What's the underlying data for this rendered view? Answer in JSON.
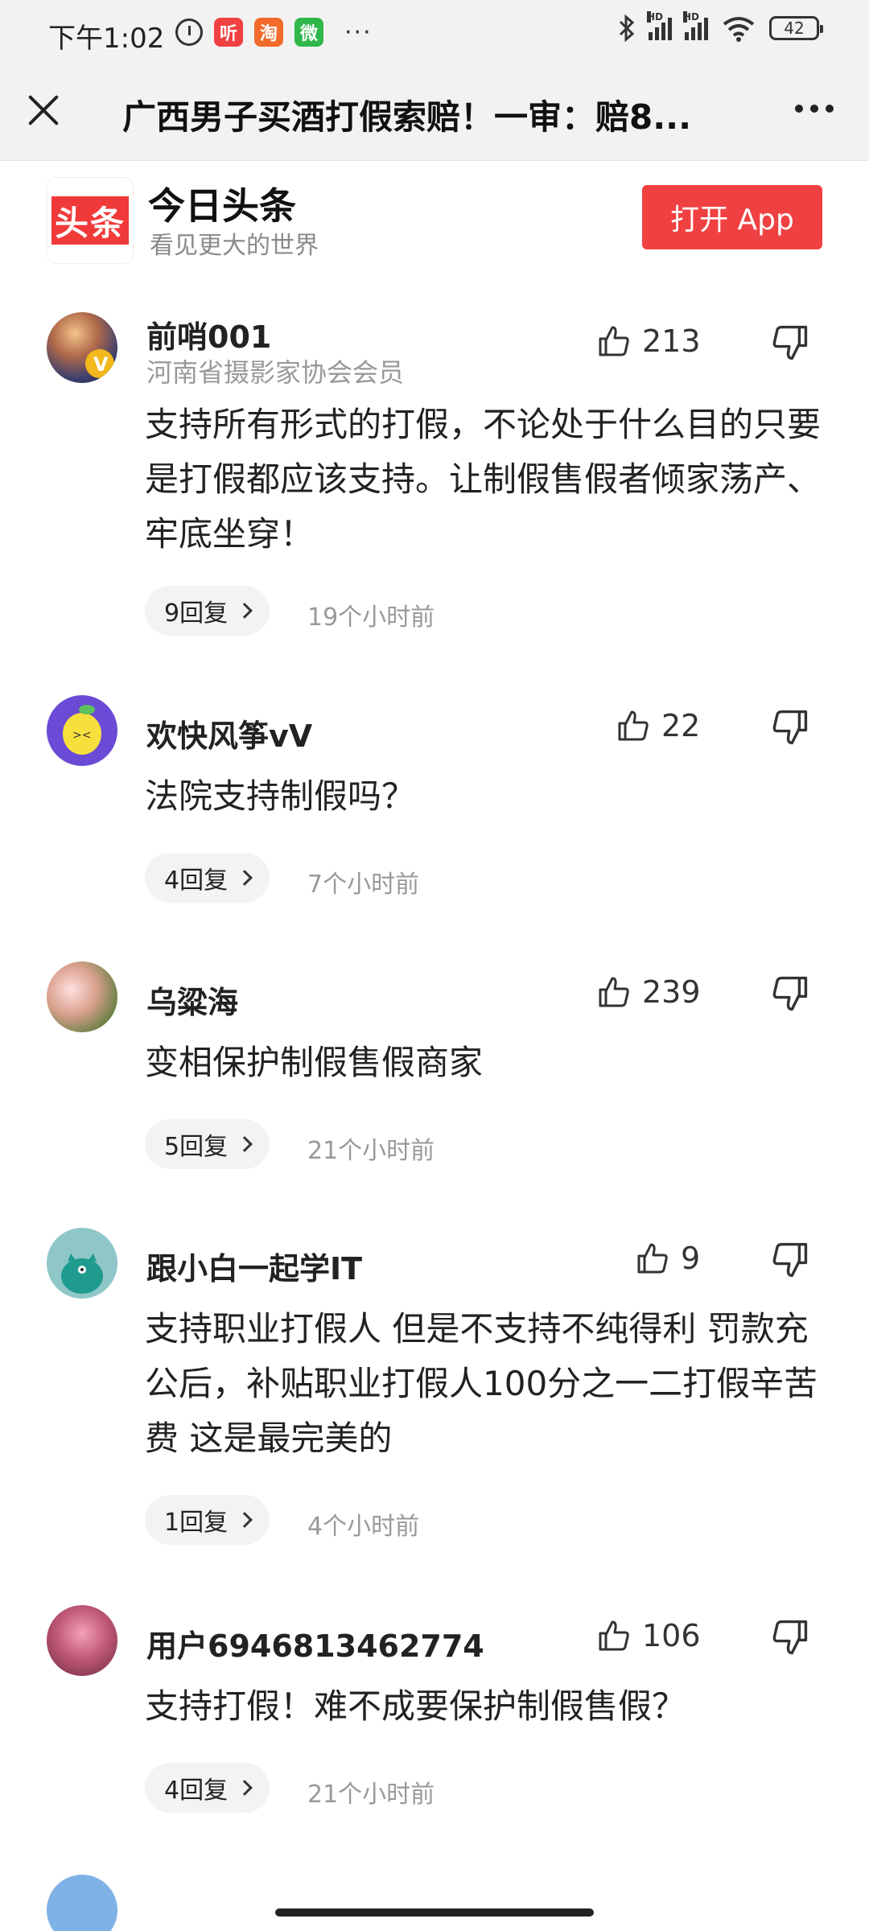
{
  "status_bar": {
    "time": "下午1:02",
    "app_icons": [
      {
        "name": "alarm-icon"
      },
      {
        "name": "listen-app-icon",
        "label": "听",
        "color": "#f04142"
      },
      {
        "name": "taobao-app-icon",
        "label": "淘",
        "color": "#f26b2a"
      },
      {
        "name": "wechat-app-icon",
        "label": "微",
        "color": "#2fb74a"
      }
    ],
    "more": "···",
    "network_badge_1": "HD",
    "network_badge_2": "HD",
    "battery": "42"
  },
  "header": {
    "title": "广西男子买酒打假索赔！一审：赔8..."
  },
  "brand": {
    "logo_text": "头条",
    "name": "今日头条",
    "slogan": "看见更大的世界",
    "open_app_label": "打开 App",
    "accent_color": "#f04142"
  },
  "comments": [
    {
      "user": "前哨001",
      "subtitle": "河南省摄影家协会会员",
      "likes": "213",
      "text": "支持所有形式的打假，不论处于什么目的只要是打假都应该支持。让制假售假者倾家荡产、牢底坐穿！",
      "replies": "9回复",
      "time": "19个小时前"
    },
    {
      "user": "欢快风筝vV",
      "subtitle": "",
      "likes": "22",
      "text": "法院支持制假吗？",
      "replies": "4回复",
      "time": "7个小时前"
    },
    {
      "user": "乌粱海",
      "subtitle": "",
      "likes": "239",
      "text": "变相保护制假售假商家",
      "replies": "5回复",
      "time": "21个小时前"
    },
    {
      "user": "跟小白一起学IT",
      "subtitle": "",
      "likes": "9",
      "text": "支持职业打假人 但是不支持不纯得利 罚款充公后，补贴职业打假人100分之一二打假辛苦费 这是最完美的",
      "replies": "1回复",
      "time": "4个小时前"
    },
    {
      "user": "用户6946813462774",
      "subtitle": "",
      "likes": "106",
      "text": "支持打假！难不成要保护制假售假？",
      "replies": "4回复",
      "time": "21个小时前"
    }
  ]
}
